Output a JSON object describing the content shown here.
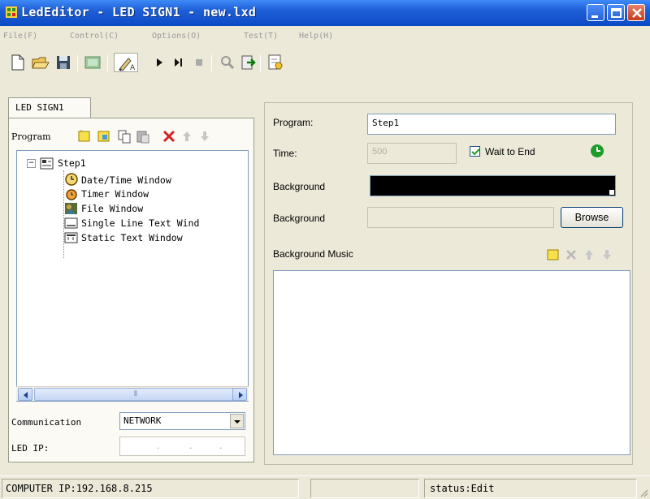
{
  "window": {
    "title": "LedEditor - LED SIGN1 - new.lxd"
  },
  "menu": [
    "File(F)",
    "Control(C)",
    "Options(O)",
    "Test(T)",
    "Help(H)"
  ],
  "toolbar": {
    "buttons": [
      "new-file-icon",
      "open-folder-icon",
      "save-icon",
      "screen-icon",
      "edit-icon",
      "play-icon",
      "step-icon",
      "stop-icon",
      "zoom-icon",
      "export-icon",
      "properties-icon"
    ]
  },
  "left": {
    "tab_label": "LED SIGN1",
    "program_label": "Program",
    "tree": {
      "root": "Step1",
      "children": [
        {
          "label": "Date/Time Window",
          "icon": "clock-icon"
        },
        {
          "label": "Timer Window",
          "icon": "timer-icon"
        },
        {
          "label": "File Window",
          "icon": "file-window-icon"
        },
        {
          "label": "Single Line Text Wind",
          "icon": "single-line-text-icon"
        },
        {
          "label": "Static Text Window",
          "icon": "static-text-icon"
        }
      ]
    },
    "communication_label": "Communication",
    "communication_value": "NETWORK",
    "led_ip_label": "LED IP:",
    "led_ip_dots": ".",
    "scroll_thumb_grip": "⦀"
  },
  "right": {
    "program_label": "Program:",
    "program_value": "Step1",
    "time_label": "Time:",
    "time_value": "500",
    "wait_to_end_label": "Wait to End",
    "wait_to_end_checked": true,
    "background_color_label": "Background",
    "background_color": "#000000",
    "background_image_label": "Background",
    "background_image_value": "",
    "browse_label": "Browse",
    "music_label": "Background Music"
  },
  "status": {
    "computer_ip": "COMPUTER IP:192.168.8.215",
    "middle": "",
    "state": "status:Edit"
  },
  "colors": {
    "titlebar": "#0b49c6",
    "window_bg": "#ece9d8",
    "accent_green": "#1e9c2a"
  }
}
